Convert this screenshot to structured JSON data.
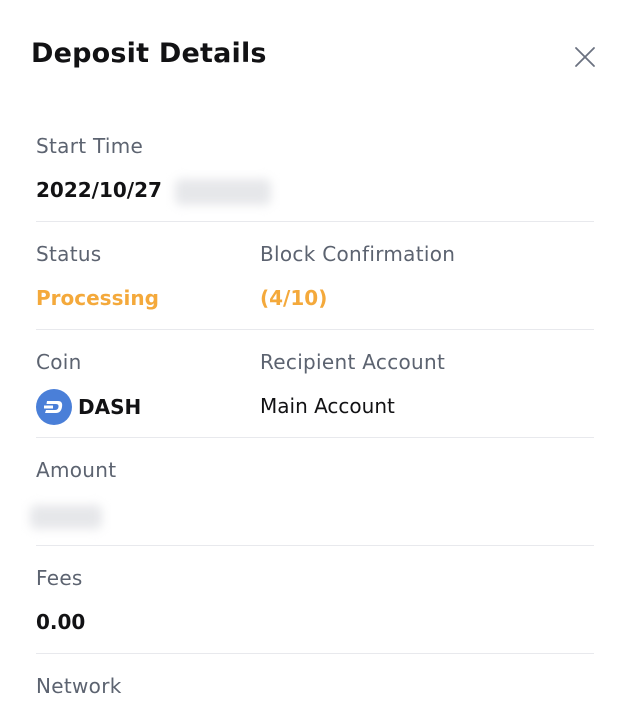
{
  "modal": {
    "title": "Deposit Details"
  },
  "start_time": {
    "label": "Start Time",
    "value": "2022/10/27"
  },
  "status": {
    "label": "Status",
    "value": "Processing"
  },
  "block_confirmation": {
    "label": "Block Confirmation",
    "value": "(4/10)"
  },
  "coin": {
    "label": "Coin",
    "value": "DASH",
    "icon": "dash-coin-icon"
  },
  "recipient_account": {
    "label": "Recipient Account",
    "value": "Main Account"
  },
  "amount": {
    "label": "Amount"
  },
  "fees": {
    "label": "Fees",
    "value": "0.00"
  },
  "network": {
    "label": "Network"
  },
  "colors": {
    "accent_warning": "#f4a93b",
    "label_gray": "#5c6370",
    "divider": "#e8e9ed",
    "dash_blue": "#4a7fd8"
  }
}
